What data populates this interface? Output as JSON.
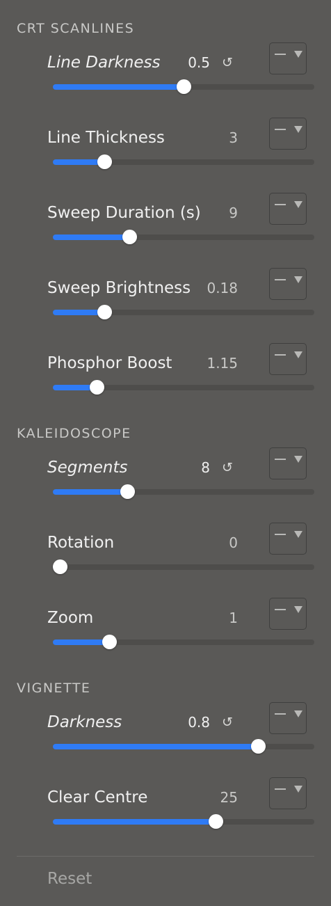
{
  "sections": [
    {
      "title": "CRT SCANLINES",
      "params": [
        {
          "label": "Line Darkness",
          "value": "0.5",
          "fraction": 0.5,
          "modified": true
        },
        {
          "label": "Line Thickness",
          "value": "3",
          "fraction": 0.196,
          "modified": false
        },
        {
          "label": "Sweep Duration (s)",
          "value": "9",
          "fraction": 0.293,
          "modified": false
        },
        {
          "label": "Sweep Brightness",
          "value": "0.18",
          "fraction": 0.196,
          "modified": false
        },
        {
          "label": "Phosphor Boost",
          "value": "1.15",
          "fraction": 0.168,
          "modified": false
        }
      ]
    },
    {
      "title": "KALEIDOSCOPE",
      "params": [
        {
          "label": "Segments",
          "value": "8",
          "fraction": 0.285,
          "modified": true
        },
        {
          "label": "Rotation",
          "value": "0",
          "fraction": 0.027,
          "modified": false
        },
        {
          "label": "Zoom",
          "value": "1",
          "fraction": 0.215,
          "modified": false
        }
      ]
    },
    {
      "title": "VIGNETTE",
      "params": [
        {
          "label": "Darkness",
          "value": "0.8",
          "fraction": 0.785,
          "modified": true
        },
        {
          "label": "Clear Centre",
          "value": "25",
          "fraction": 0.622,
          "modified": false
        }
      ]
    }
  ],
  "icons": {
    "reset": "↺",
    "mode_dash": "dash-icon",
    "mode_caret": "caret-down-icon"
  },
  "colors": {
    "background": "#5a5957",
    "accent": "#2f7bf5",
    "track": "#4e4d4b",
    "thumb": "#ffffff"
  },
  "footer": {
    "reset_label": "Reset"
  }
}
